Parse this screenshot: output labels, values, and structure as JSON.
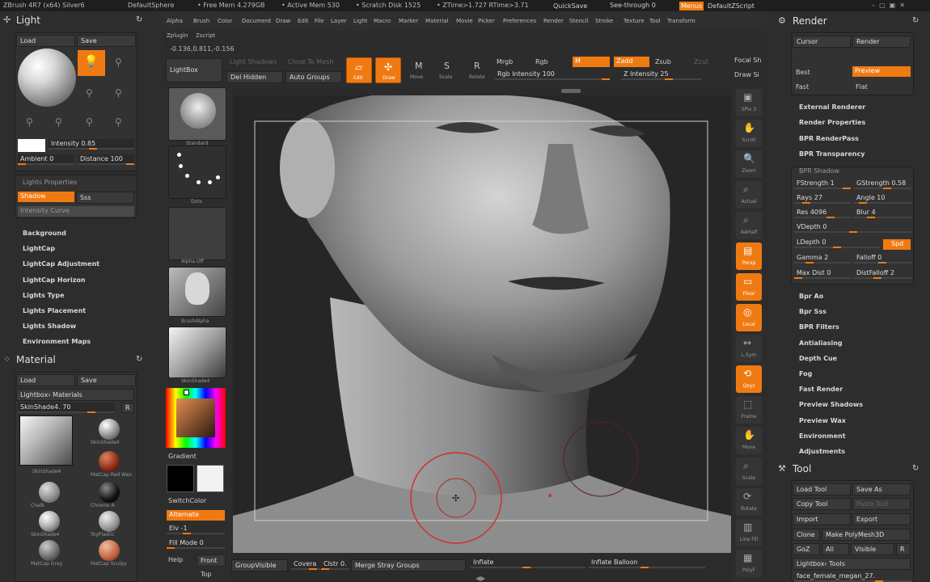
{
  "titlebar": {
    "app": "ZBrush 4R7 (x64) Silver6",
    "document": "DefaultSphere",
    "free_mem": "• Free Mem 4.279GB",
    "active_mem": "• Active Mem 530",
    "scratch": "• Scratch Disk 1525",
    "ztime": "• ZTime≻1.727 RTime≻3.71",
    "quicksave": "QuickSave",
    "seethrough": "See-through  0",
    "menus": "Menus",
    "script": "DefaultZScript"
  },
  "menubar": [
    "Alpha",
    "Brush",
    "Color",
    "Document",
    "Draw",
    "Edit",
    "File",
    "Layer",
    "Light",
    "Macro",
    "Marker",
    "Material",
    "Movie",
    "Picker",
    "Preferences",
    "Render",
    "Stencil",
    "Stroke",
    "Texture",
    "Tool",
    "Transform"
  ],
  "menubar2": [
    "Zplugin",
    "Zscript"
  ],
  "coords": "-0.136,0.811,-0.156",
  "toolbar": {
    "lightbox": "LightBox",
    "light_shadows": "Light Shadows",
    "close_to_mesh": "Close To Mesh",
    "del_hidden": "Del Hidden",
    "auto_groups": "Auto Groups",
    "edit": "Edit",
    "draw": "Draw",
    "move": "Move",
    "scale": "Scale",
    "rotate": "Rotate",
    "mrgb": "Mrgb",
    "rgb": "Rgb",
    "m": "M",
    "rgb_intensity": "Rgb Intensity 100",
    "zadd": "Zadd",
    "zsub": "Zsub",
    "zcut": "Zcut",
    "z_intensity": "Z Intensity 25",
    "focal": "Focal Sh",
    "draw_size": "Draw Si"
  },
  "light": {
    "title": "Light",
    "load": "Load",
    "save": "Save",
    "intensity": "Intensity 0.85",
    "ambient": "Ambient 0",
    "distance": "Distance 100",
    "lights_properties": "Lights Properties",
    "shadow": "Shadow",
    "sss": "Sss",
    "intensity_curve": "Intensity Curve",
    "items": [
      "Background",
      "LightCap",
      "LightCap Adjustment",
      "LightCap Horizon",
      "Lights Type",
      "Lights Placement",
      "Lights Shadow",
      "Environment Maps"
    ]
  },
  "material": {
    "title": "Material",
    "load": "Load",
    "save": "Save",
    "lightbox_materials": "Lightbox› Materials",
    "skinshade": "SkinShade4. 70",
    "r": "R",
    "current_label": "SkinShade4",
    "items": [
      {
        "name": "SkinShade4"
      },
      {
        "name": "MatCap Red Wax"
      },
      {
        "name": "Chalk"
      },
      {
        "name": "Chrome A"
      },
      {
        "name": "SkinShade4"
      },
      {
        "name": "ToyPlastic"
      },
      {
        "name": "MatCap Gray"
      },
      {
        "name": "MatCap Sculpy"
      }
    ]
  },
  "shelf": {
    "standard": "Standard",
    "dots": "Dots",
    "alpha_off": "Alpha Off",
    "brush_alpha": "BrushAlpha",
    "skin_shade": "SkinShade4",
    "gradient": "Gradient",
    "switchcolor": "SwitchColor",
    "alternate": "Alternate",
    "elv": "Elv -1",
    "fill_mode": "Fill Mode 0",
    "help": "Help",
    "front": "Front",
    "top": "Top"
  },
  "right_shelf": [
    "SPix 3",
    "Scroll",
    "Zoom",
    "Actual",
    "AAHalf",
    "Persp",
    "Floor",
    "Local",
    "L.Sym",
    "Qxyz",
    "Frame",
    "Move",
    "Scale",
    "Rotate",
    "Line Fill",
    "PolyF"
  ],
  "bottom": {
    "groupvisible": "GroupVisible",
    "coverage": "Covera",
    "clstr": "Clstr 0.",
    "merge": "Merge Stray Groups",
    "inflate": "Inflate",
    "inflate_balloon": "Inflate Balloon"
  },
  "render": {
    "title": "Render",
    "cursor": "Cursor",
    "render_btn": "Render",
    "best": "Best",
    "preview": "Preview",
    "fast": "Fast",
    "flat": "Flat",
    "items": [
      "External Renderer",
      "Render Properties",
      "BPR RenderPass",
      "BPR Transparency"
    ],
    "bpr_shadow": "BPR Shadow",
    "fstrength": "FStrength 1",
    "gstrength": "GStrength 0.58",
    "rays": "Rays 27",
    "angle": "Angle 10",
    "res": "Res 4096",
    "blur": "Blur 4",
    "vdepth": "VDepth 0",
    "ldepth": "LDepth 0",
    "spd": "Spd",
    "gamma": "Gamma 2",
    "falloff": "Falloff 0",
    "maxdist": "Max Dist 0",
    "distfalloff": "DistFalloff 2",
    "items2": [
      "Bpr Ao",
      "Bpr Sss",
      "BPR Filters",
      "Antialiasing",
      "Depth Cue",
      "Fog",
      "Fast Render",
      "Preview Shadows",
      "Preview Wax",
      "Environment",
      "Adjustments"
    ]
  },
  "tool": {
    "title": "Tool",
    "load": "Load Tool",
    "saveas": "Save As",
    "copy": "Copy Tool",
    "paste": "Paste Tool",
    "import": "Import",
    "export": "Export",
    "clone": "Clone",
    "make": "Make PolyMesh3D",
    "goz": "GoZ",
    "all": "All",
    "visible": "Visible",
    "r": "R",
    "lightbox_tools": "Lightbox› Tools",
    "current": "face_female_megan_27."
  },
  "colors": {
    "accent": "#f07a12",
    "bg": "#2b2b2b",
    "canvas": "#242424"
  }
}
